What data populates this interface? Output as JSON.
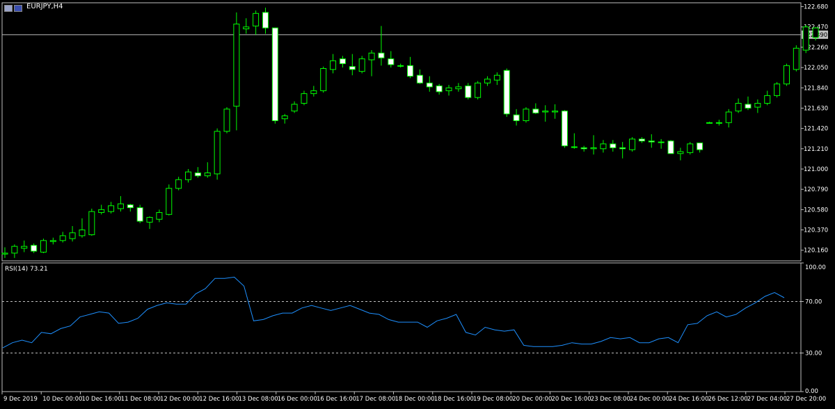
{
  "header": {
    "symbol": "EURJPY,H4"
  },
  "price_panel": {
    "current_price_label": "122.390",
    "price_ticks": [
      "122.680",
      "122.470",
      "122.260",
      "122.050",
      "121.840",
      "121.630",
      "121.420",
      "121.210",
      "121.000",
      "120.790",
      "120.580",
      "120.370",
      "120.160"
    ]
  },
  "rsi_panel": {
    "title": "RSI(14) 73.21",
    "level_ticks": [
      "100.00",
      "70.00",
      "30.00",
      "0.00"
    ]
  },
  "time_axis": [
    "9 Dec 2019",
    "10 Dec 00:00",
    "10 Dec 16:00",
    "11 Dec 08:00",
    "12 Dec 00:00",
    "12 Dec 16:00",
    "13 Dec 08:00",
    "16 Dec 00:00",
    "16 Dec 16:00",
    "17 Dec 08:00",
    "18 Dec 00:00",
    "18 Dec 16:00",
    "19 Dec 08:00",
    "20 Dec 00:00",
    "20 Dec 16:00",
    "23 Dec 08:00",
    "24 Dec 00:00",
    "24 Dec 16:00",
    "26 Dec 12:00",
    "27 Dec 04:00",
    "27 Dec 20:00"
  ],
  "colors": {
    "bull_body": "#000000",
    "bear_body": "#ffffff",
    "wick": "#00ff00",
    "rsi_line": "#1e90ff",
    "grid_dash": "#c0c0c0",
    "panel_border": "#c0c0c0",
    "price_line": "#c0c0c0"
  },
  "chart_data": [
    {
      "type": "candlestick",
      "title": "EURJPY,H4",
      "ylim": [
        120.05,
        122.72
      ],
      "current_price": 122.39,
      "candles": [
        {
          "o": 120.12,
          "h": 120.19,
          "l": 120.08,
          "c": 120.13
        },
        {
          "o": 120.13,
          "h": 120.22,
          "l": 120.08,
          "c": 120.2
        },
        {
          "o": 120.18,
          "h": 120.26,
          "l": 120.14,
          "c": 120.2
        },
        {
          "o": 120.21,
          "h": 120.23,
          "l": 120.13,
          "c": 120.15
        },
        {
          "o": 120.14,
          "h": 120.28,
          "l": 120.13,
          "c": 120.26
        },
        {
          "o": 120.25,
          "h": 120.29,
          "l": 120.22,
          "c": 120.26
        },
        {
          "o": 120.26,
          "h": 120.35,
          "l": 120.24,
          "c": 120.31
        },
        {
          "o": 120.28,
          "h": 120.41,
          "l": 120.25,
          "c": 120.34
        },
        {
          "o": 120.31,
          "h": 120.49,
          "l": 120.29,
          "c": 120.37
        },
        {
          "o": 120.32,
          "h": 120.59,
          "l": 120.31,
          "c": 120.56
        },
        {
          "o": 120.55,
          "h": 120.63,
          "l": 120.53,
          "c": 120.58
        },
        {
          "o": 120.56,
          "h": 120.66,
          "l": 120.54,
          "c": 120.62
        },
        {
          "o": 120.59,
          "h": 120.72,
          "l": 120.56,
          "c": 120.64
        },
        {
          "o": 120.63,
          "h": 120.64,
          "l": 120.56,
          "c": 120.6
        },
        {
          "o": 120.6,
          "h": 120.63,
          "l": 120.44,
          "c": 120.46
        },
        {
          "o": 120.45,
          "h": 120.51,
          "l": 120.38,
          "c": 120.5
        },
        {
          "o": 120.48,
          "h": 120.58,
          "l": 120.45,
          "c": 120.55
        },
        {
          "o": 120.53,
          "h": 120.84,
          "l": 120.52,
          "c": 120.8
        },
        {
          "o": 120.8,
          "h": 120.92,
          "l": 120.78,
          "c": 120.89
        },
        {
          "o": 120.89,
          "h": 121.0,
          "l": 120.86,
          "c": 120.97
        },
        {
          "o": 120.96,
          "h": 121.02,
          "l": 120.91,
          "c": 120.93
        },
        {
          "o": 120.93,
          "h": 121.07,
          "l": 120.91,
          "c": 120.96
        },
        {
          "o": 120.95,
          "h": 121.42,
          "l": 120.89,
          "c": 121.39
        },
        {
          "o": 121.39,
          "h": 121.64,
          "l": 121.37,
          "c": 121.62
        },
        {
          "o": 121.65,
          "h": 122.62,
          "l": 121.4,
          "c": 122.5
        },
        {
          "o": 122.45,
          "h": 122.56,
          "l": 122.4,
          "c": 122.47
        },
        {
          "o": 122.48,
          "h": 122.64,
          "l": 122.39,
          "c": 122.61
        },
        {
          "o": 122.62,
          "h": 122.67,
          "l": 122.4,
          "c": 122.46
        },
        {
          "o": 122.46,
          "h": 122.46,
          "l": 121.47,
          "c": 121.5
        },
        {
          "o": 121.52,
          "h": 121.57,
          "l": 121.47,
          "c": 121.55
        },
        {
          "o": 121.6,
          "h": 121.7,
          "l": 121.58,
          "c": 121.67
        },
        {
          "o": 121.68,
          "h": 121.81,
          "l": 121.66,
          "c": 121.78
        },
        {
          "o": 121.78,
          "h": 121.86,
          "l": 121.75,
          "c": 121.81
        },
        {
          "o": 121.81,
          "h": 122.06,
          "l": 121.79,
          "c": 122.04
        },
        {
          "o": 122.03,
          "h": 122.19,
          "l": 121.99,
          "c": 122.12
        },
        {
          "o": 122.14,
          "h": 122.17,
          "l": 122.05,
          "c": 122.09
        },
        {
          "o": 122.06,
          "h": 122.19,
          "l": 121.97,
          "c": 122.03
        },
        {
          "o": 122.01,
          "h": 122.17,
          "l": 121.99,
          "c": 122.14
        },
        {
          "o": 122.13,
          "h": 122.23,
          "l": 121.96,
          "c": 122.2
        },
        {
          "o": 122.2,
          "h": 122.48,
          "l": 122.07,
          "c": 122.15
        },
        {
          "o": 122.14,
          "h": 122.22,
          "l": 122.05,
          "c": 122.08
        },
        {
          "o": 122.07,
          "h": 122.09,
          "l": 122.05,
          "c": 122.07
        },
        {
          "o": 122.07,
          "h": 122.16,
          "l": 121.94,
          "c": 121.96
        },
        {
          "o": 121.97,
          "h": 122.03,
          "l": 121.88,
          "c": 121.89
        },
        {
          "o": 121.89,
          "h": 121.96,
          "l": 121.8,
          "c": 121.85
        },
        {
          "o": 121.86,
          "h": 121.88,
          "l": 121.77,
          "c": 121.8
        },
        {
          "o": 121.81,
          "h": 121.87,
          "l": 121.76,
          "c": 121.84
        },
        {
          "o": 121.83,
          "h": 121.89,
          "l": 121.8,
          "c": 121.85
        },
        {
          "o": 121.86,
          "h": 121.89,
          "l": 121.72,
          "c": 121.74
        },
        {
          "o": 121.74,
          "h": 121.91,
          "l": 121.72,
          "c": 121.89
        },
        {
          "o": 121.89,
          "h": 121.96,
          "l": 121.86,
          "c": 121.93
        },
        {
          "o": 121.92,
          "h": 122.0,
          "l": 121.87,
          "c": 121.97
        },
        {
          "o": 122.02,
          "h": 122.04,
          "l": 121.54,
          "c": 121.57
        },
        {
          "o": 121.56,
          "h": 121.62,
          "l": 121.45,
          "c": 121.5
        },
        {
          "o": 121.5,
          "h": 121.64,
          "l": 121.48,
          "c": 121.62
        },
        {
          "o": 121.62,
          "h": 121.68,
          "l": 121.57,
          "c": 121.58
        },
        {
          "o": 121.59,
          "h": 121.66,
          "l": 121.49,
          "c": 121.6
        },
        {
          "o": 121.59,
          "h": 121.67,
          "l": 121.52,
          "c": 121.6
        },
        {
          "o": 121.6,
          "h": 121.61,
          "l": 121.22,
          "c": 121.24
        },
        {
          "o": 121.23,
          "h": 121.37,
          "l": 121.21,
          "c": 121.23
        },
        {
          "o": 121.22,
          "h": 121.24,
          "l": 121.18,
          "c": 121.21
        },
        {
          "o": 121.21,
          "h": 121.35,
          "l": 121.15,
          "c": 121.22
        },
        {
          "o": 121.21,
          "h": 121.3,
          "l": 121.17,
          "c": 121.26
        },
        {
          "o": 121.26,
          "h": 121.3,
          "l": 121.18,
          "c": 121.22
        },
        {
          "o": 121.22,
          "h": 121.28,
          "l": 121.11,
          "c": 121.21
        },
        {
          "o": 121.2,
          "h": 121.33,
          "l": 121.18,
          "c": 121.31
        },
        {
          "o": 121.31,
          "h": 121.33,
          "l": 121.27,
          "c": 121.29
        },
        {
          "o": 121.29,
          "h": 121.36,
          "l": 121.22,
          "c": 121.28
        },
        {
          "o": 121.28,
          "h": 121.31,
          "l": 121.21,
          "c": 121.28
        },
        {
          "o": 121.29,
          "h": 121.3,
          "l": 121.16,
          "c": 121.16
        },
        {
          "o": 121.16,
          "h": 121.22,
          "l": 121.09,
          "c": 121.18
        },
        {
          "o": 121.17,
          "h": 121.28,
          "l": 121.15,
          "c": 121.26
        },
        {
          "o": 121.27,
          "h": 121.27,
          "l": 121.17,
          "c": 121.2
        },
        {
          "o": 121.48,
          "h": 121.49,
          "l": 121.47,
          "c": 121.48
        },
        {
          "o": 121.48,
          "h": 121.51,
          "l": 121.45,
          "c": 121.48
        },
        {
          "o": 121.48,
          "h": 121.62,
          "l": 121.43,
          "c": 121.59
        },
        {
          "o": 121.6,
          "h": 121.73,
          "l": 121.58,
          "c": 121.68
        },
        {
          "o": 121.67,
          "h": 121.75,
          "l": 121.61,
          "c": 121.63
        },
        {
          "o": 121.64,
          "h": 121.72,
          "l": 121.58,
          "c": 121.68
        },
        {
          "o": 121.68,
          "h": 121.81,
          "l": 121.66,
          "c": 121.76
        },
        {
          "o": 121.76,
          "h": 121.9,
          "l": 121.74,
          "c": 121.88
        },
        {
          "o": 121.88,
          "h": 122.09,
          "l": 121.86,
          "c": 122.07
        },
        {
          "o": 122.03,
          "h": 122.28,
          "l": 122.01,
          "c": 122.25
        },
        {
          "o": 122.23,
          "h": 122.49,
          "l": 122.2,
          "c": 122.47
        },
        {
          "o": 122.36,
          "h": 122.47,
          "l": 122.33,
          "c": 122.46
        }
      ]
    },
    {
      "type": "line",
      "title": "RSI(14) 73.21",
      "ylim": [
        0,
        100
      ],
      "levels": [
        70,
        30
      ],
      "series": [
        {
          "values": [
            34,
            38,
            40,
            38,
            46,
            45,
            49,
            51,
            58,
            60,
            62,
            61,
            53,
            54,
            57,
            64,
            67,
            69,
            68,
            68,
            76,
            80,
            88,
            88,
            89,
            82,
            55,
            56,
            59,
            61,
            61,
            65,
            67,
            65,
            63,
            65,
            67,
            64,
            61,
            60,
            56,
            54,
            54,
            54,
            50,
            55,
            57,
            60,
            46,
            44,
            50,
            48,
            47,
            48,
            36,
            35,
            35,
            35,
            36,
            38,
            37,
            37,
            39,
            42,
            41,
            42,
            38,
            38,
            41,
            42,
            38,
            52,
            53,
            59,
            62,
            58,
            60,
            65,
            69,
            74,
            77,
            73
          ]
        }
      ]
    }
  ]
}
